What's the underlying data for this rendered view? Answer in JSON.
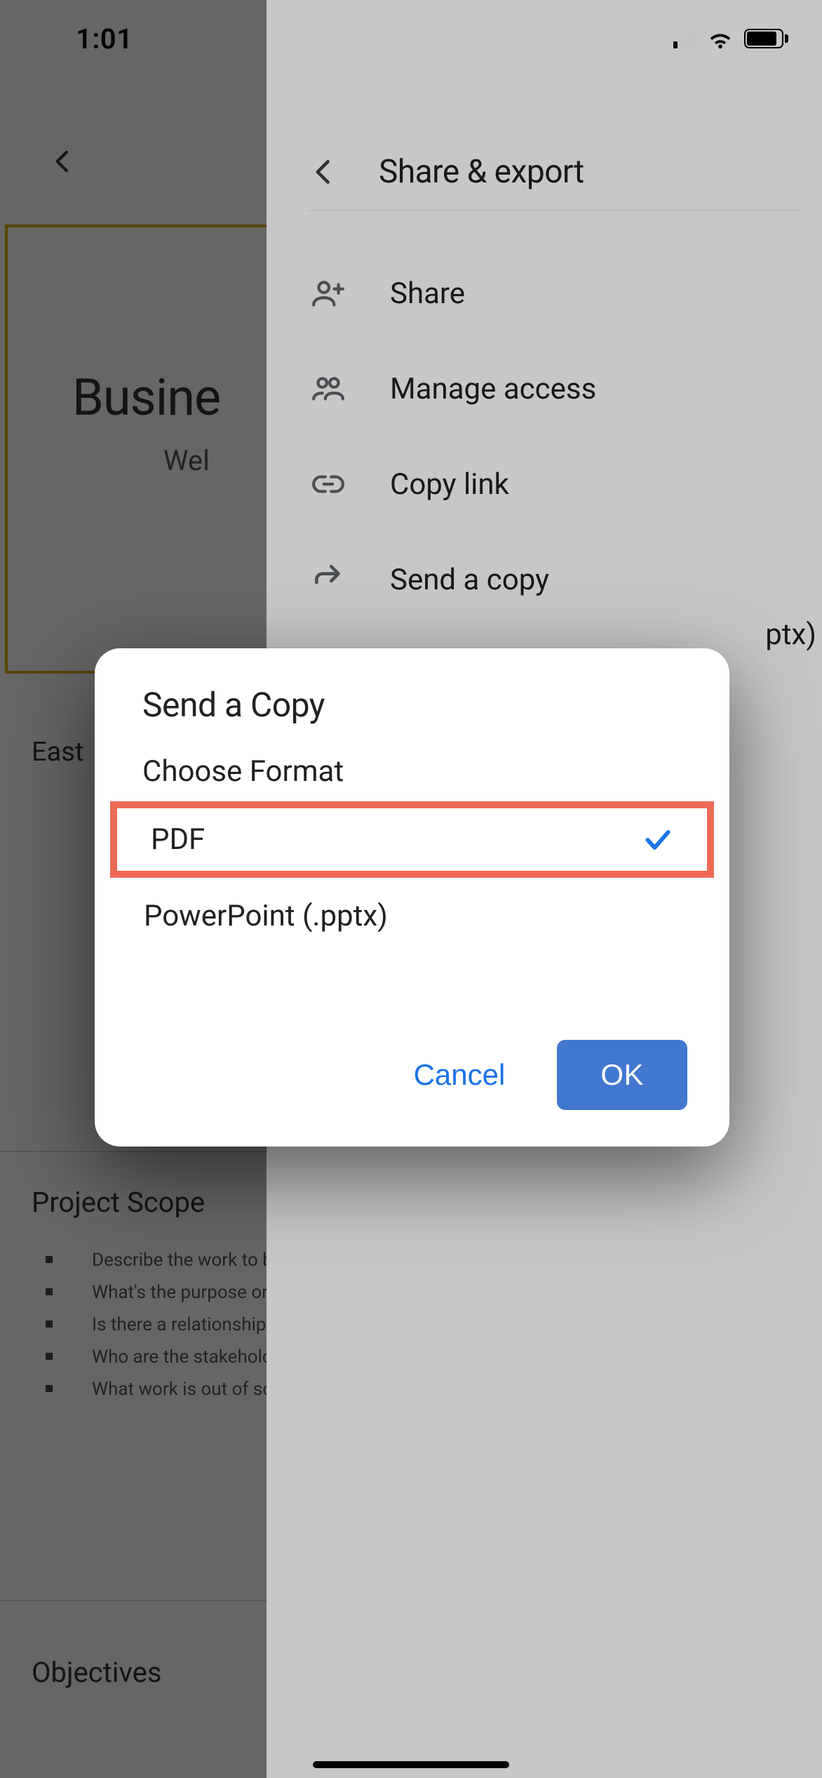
{
  "statusbar": {
    "time": "1:01"
  },
  "background": {
    "slide_title": "Busine",
    "slide_sub": "Wel",
    "thumb_label": "East",
    "scope_title": "Project Scope",
    "scope_items": [
      "Describe the work to be",
      "What's the purpose or bu",
      "Is there a relationship to",
      "Who are the stakeholder",
      "What work is out of scop"
    ],
    "objectives_title": "Objectives"
  },
  "sheet": {
    "title": "Share & export",
    "items": [
      {
        "icon": "person-add-icon",
        "label": "Share"
      },
      {
        "icon": "people-icon",
        "label": "Manage access"
      },
      {
        "icon": "link-icon",
        "label": "Copy link"
      },
      {
        "icon": "arrow-forward-icon",
        "label": "Send a copy"
      }
    ],
    "pptx_trail": "ptx)"
  },
  "dialog": {
    "title": "Send a Copy",
    "subtitle": "Choose Format",
    "options": [
      {
        "label": "PDF",
        "selected": true
      },
      {
        "label": "PowerPoint (.pptx)",
        "selected": false
      }
    ],
    "cancel_label": "Cancel",
    "ok_label": "OK"
  }
}
